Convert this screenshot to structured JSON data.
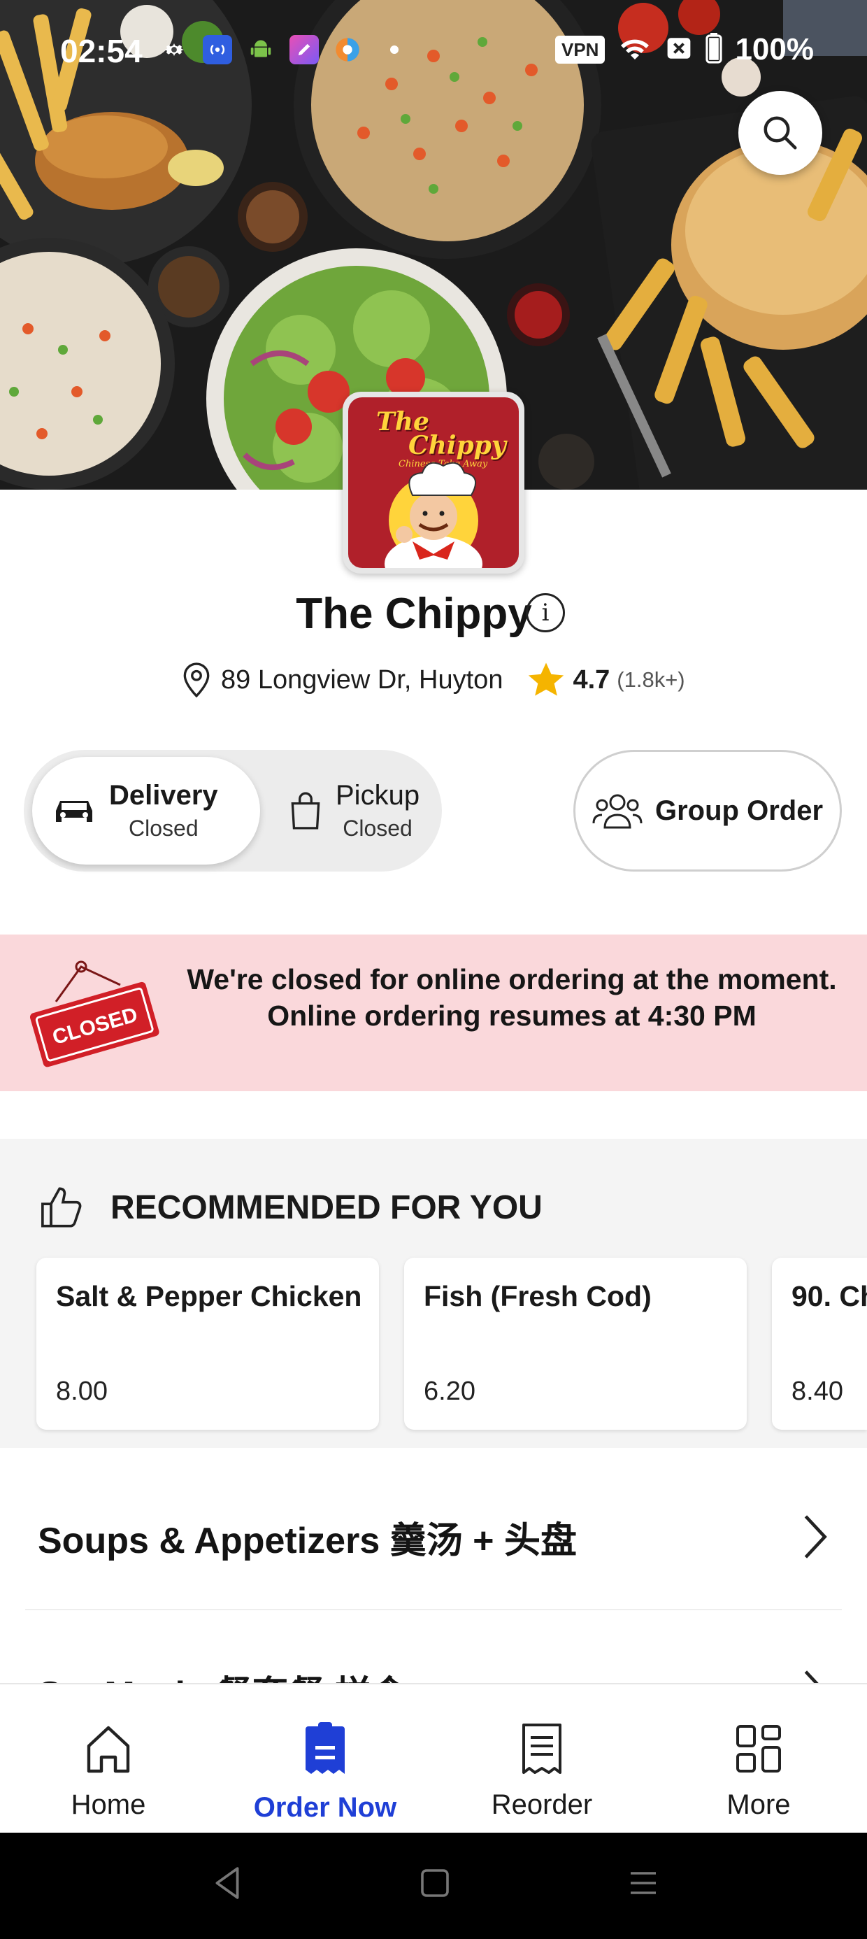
{
  "status_bar": {
    "time": "02:54",
    "vpn_label": "VPN",
    "battery": "100%"
  },
  "restaurant": {
    "name": "The Chippy",
    "address": "89 Longview Dr, Huyton",
    "rating": "4.7",
    "rating_count": "(1.8k+)",
    "logo_title_line1": "The",
    "logo_title_line2": "Chippy",
    "logo_subtitle": "Chinese Take Away"
  },
  "order_modes": [
    {
      "label": "Delivery",
      "status": "Closed",
      "active": true
    },
    {
      "label": "Pickup",
      "status": "Closed",
      "active": false
    }
  ],
  "group_order_label": "Group Order",
  "closed_banner": {
    "sign_text": "CLOSED",
    "line1": "We're closed for online ordering at the moment.",
    "line2": "Online ordering resumes at 4:30 PM"
  },
  "recommended": {
    "title": "RECOMMENDED FOR YOU",
    "items": [
      {
        "name": "Salt & Pepper Chicken",
        "price": "8.00"
      },
      {
        "name": "Fish (Fresh Cod)",
        "price": "6.20"
      },
      {
        "name": "90. Ch",
        "price": "8.40"
      }
    ]
  },
  "categories": [
    {
      "label": "Soups & Appetizers 羹汤 + 头盘"
    },
    {
      "label": "Set Meals 餐套餐 样食"
    }
  ],
  "bottom_nav": [
    {
      "label": "Home",
      "icon": "home-icon",
      "active": false
    },
    {
      "label": "Order Now",
      "icon": "order-icon",
      "active": true
    },
    {
      "label": "Reorder",
      "icon": "receipt-icon",
      "active": false
    },
    {
      "label": "More",
      "icon": "grid-icon",
      "active": false
    }
  ],
  "colors": {
    "accent": "#1f3fd6",
    "banner_bg": "#fad8db",
    "logo_red": "#b0202a",
    "star": "#f5b400"
  }
}
